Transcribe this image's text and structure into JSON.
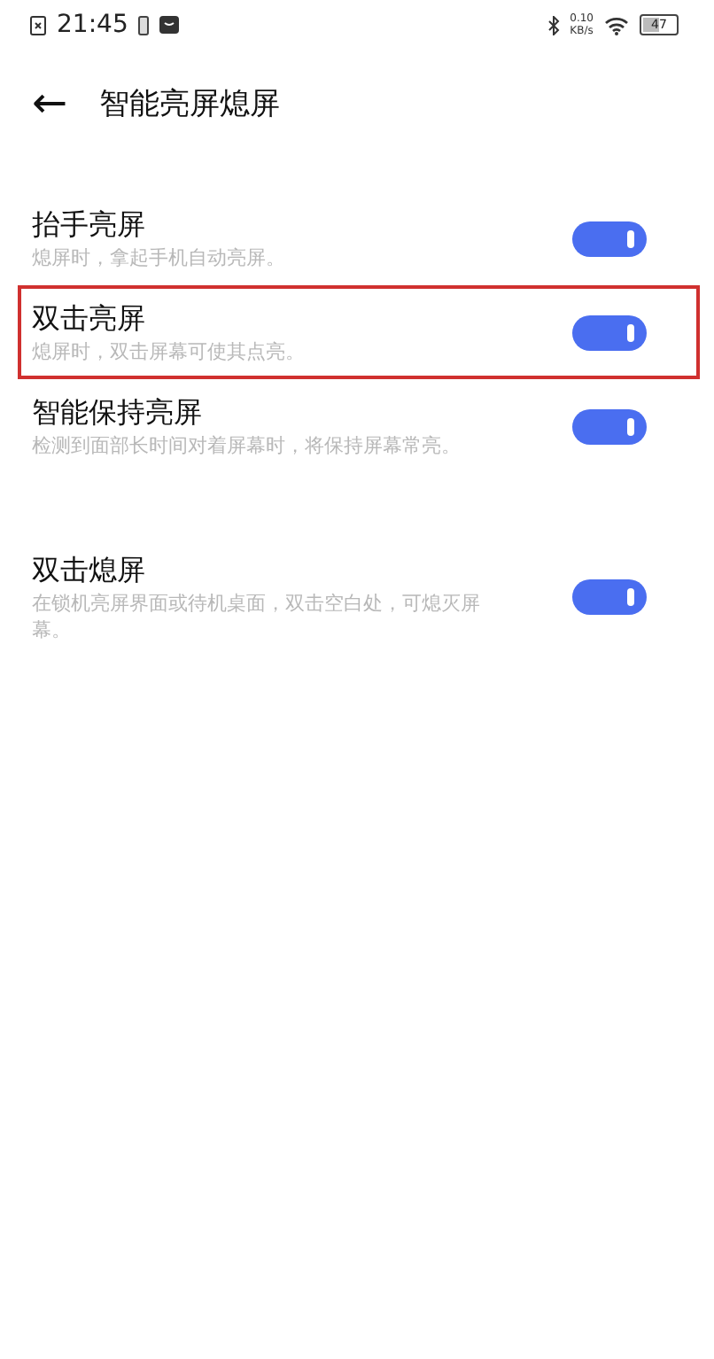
{
  "status_bar": {
    "time": "21:45",
    "speed_value": "0.10",
    "speed_unit": "KB/s",
    "battery": "47"
  },
  "header": {
    "back": "←",
    "title": "智能亮屏熄屏"
  },
  "groups": [
    {
      "items": [
        {
          "title": "抬手亮屏",
          "description": "熄屏时，拿起手机自动亮屏。",
          "on": true,
          "highlighted": false
        },
        {
          "title": "双击亮屏",
          "description": "熄屏时，双击屏幕可使其点亮。",
          "on": true,
          "highlighted": true
        },
        {
          "title": "智能保持亮屏",
          "description": "检测到面部长时间对着屏幕时，将保持屏幕常亮。",
          "on": true,
          "highlighted": false
        }
      ]
    },
    {
      "items": [
        {
          "title": "双击熄屏",
          "description": "在锁机亮屏界面或待机桌面，双击空白处，可熄灭屏幕。",
          "on": true,
          "highlighted": false
        }
      ]
    }
  ]
}
